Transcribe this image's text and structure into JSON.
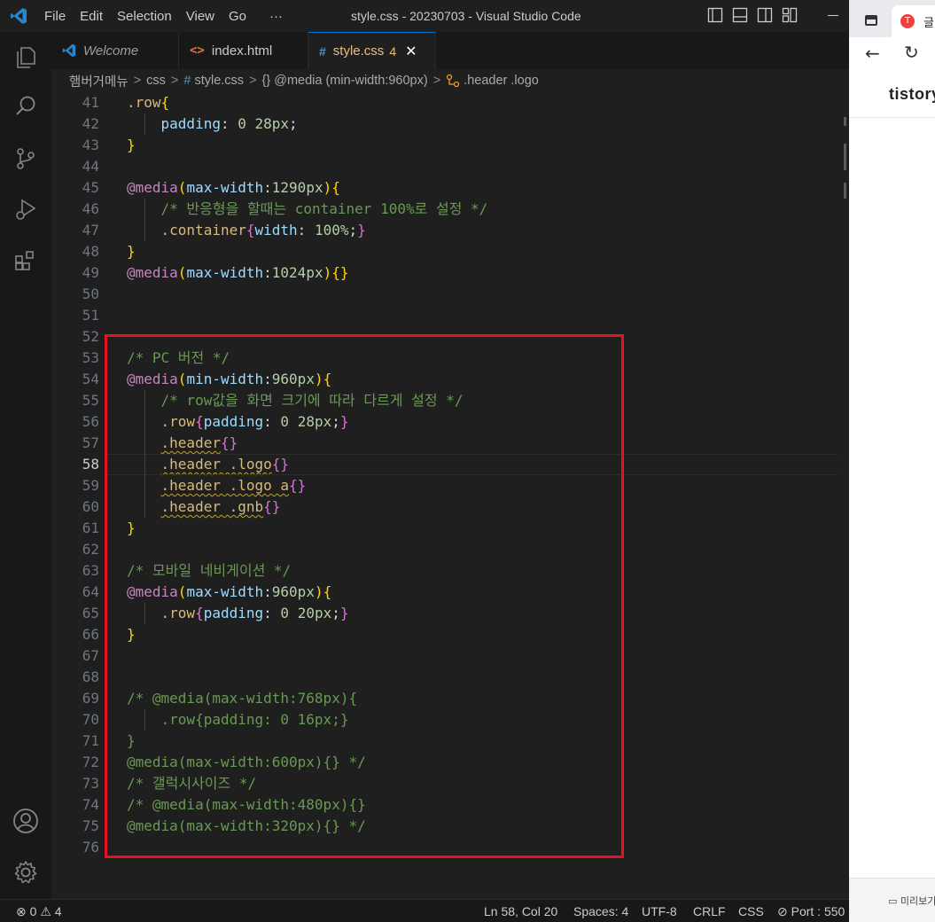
{
  "window": {
    "title": "style.css - 20230703 - Visual Studio Code",
    "menu": [
      "File",
      "Edit",
      "Selection",
      "View",
      "Go",
      "···"
    ]
  },
  "activity": {
    "items": [
      "explorer-icon",
      "search-icon",
      "source-control-icon",
      "run-debug-icon",
      "extensions-icon",
      "account-icon",
      "settings-gear-icon"
    ]
  },
  "tabs": [
    {
      "label": "Welcome",
      "icon": "vscode-icon"
    },
    {
      "label": "index.html",
      "icon": "html-icon"
    },
    {
      "label": "style.css",
      "icon": "css-icon",
      "badge": "4",
      "close": "✕",
      "active": true
    }
  ],
  "breadcrumb": {
    "folder": "햄버거메뉴",
    "subfolder": "css",
    "file_hash": "#",
    "file": "style.css",
    "media_icon": "{}",
    "media": "@media (min-width:960px)",
    "symbol": ".header .logo",
    "separator": ">"
  },
  "editor": {
    "current_line": 58,
    "colors": {
      "selector": "#d7ba7d",
      "property": "#9cdcfe",
      "number": "#b5cea8",
      "keyword": "#c586c0",
      "comment": "#6a9955",
      "bracket1": "#ffd700",
      "bracket2": "#da70d6",
      "bracket3": "#179fff"
    },
    "lines": [
      {
        "n": "41",
        "tokens": [
          [
            "sel",
            ".row"
          ],
          [
            "b1",
            "{"
          ]
        ]
      },
      {
        "n": "42",
        "tokens": [
          [
            "pl",
            "    "
          ],
          [
            "prop",
            "padding"
          ],
          [
            "pl",
            ": "
          ],
          [
            "num",
            "0"
          ],
          [
            "pl",
            " "
          ],
          [
            "num",
            "28px"
          ],
          [
            "pl",
            ";"
          ]
        ]
      },
      {
        "n": "43",
        "tokens": [
          [
            "b1",
            "}"
          ]
        ]
      },
      {
        "n": "44",
        "tokens": []
      },
      {
        "n": "45",
        "tokens": [
          [
            "kw",
            "@media"
          ],
          [
            "b1",
            "("
          ],
          [
            "prop",
            "max-width"
          ],
          [
            "pl",
            ":"
          ],
          [
            "num",
            "1290px"
          ],
          [
            "b1",
            ")"
          ],
          [
            "b1",
            "{"
          ]
        ]
      },
      {
        "n": "46",
        "tokens": [
          [
            "pl",
            "    "
          ],
          [
            "com",
            "/* 반응형을 할때는 container 100%로 설정 */"
          ]
        ]
      },
      {
        "n": "47",
        "tokens": [
          [
            "pl",
            "    "
          ],
          [
            "sel",
            ".container"
          ],
          [
            "b2",
            "{"
          ],
          [
            "prop",
            "width"
          ],
          [
            "pl",
            ": "
          ],
          [
            "num",
            "100%"
          ],
          [
            "pl",
            ";"
          ],
          [
            "b2",
            "}"
          ]
        ]
      },
      {
        "n": "48",
        "tokens": [
          [
            "b1",
            "}"
          ]
        ]
      },
      {
        "n": "49",
        "tokens": [
          [
            "kw",
            "@media"
          ],
          [
            "b1",
            "("
          ],
          [
            "prop",
            "max-width"
          ],
          [
            "pl",
            ":"
          ],
          [
            "num",
            "1024px"
          ],
          [
            "b1",
            ")"
          ],
          [
            "b1",
            "{}"
          ]
        ]
      },
      {
        "n": "50",
        "tokens": []
      },
      {
        "n": "51",
        "tokens": []
      },
      {
        "n": "52",
        "tokens": []
      },
      {
        "n": "53",
        "tokens": [
          [
            "com",
            "/* PC 버전 */"
          ]
        ]
      },
      {
        "n": "54",
        "tokens": [
          [
            "kw",
            "@media"
          ],
          [
            "b1",
            "("
          ],
          [
            "prop",
            "min-width"
          ],
          [
            "pl",
            ":"
          ],
          [
            "num",
            "960px"
          ],
          [
            "b1",
            ")"
          ],
          [
            "b1",
            "{"
          ]
        ]
      },
      {
        "n": "55",
        "tokens": [
          [
            "pl",
            "    "
          ],
          [
            "com",
            "/* row값을 화면 크기에 따라 다르게 설정 */"
          ]
        ]
      },
      {
        "n": "56",
        "tokens": [
          [
            "pl",
            "    "
          ],
          [
            "sel",
            ".row"
          ],
          [
            "b2",
            "{"
          ],
          [
            "prop",
            "padding"
          ],
          [
            "pl",
            ": "
          ],
          [
            "num",
            "0"
          ],
          [
            "pl",
            " "
          ],
          [
            "num",
            "28px"
          ],
          [
            "pl",
            ";"
          ],
          [
            "b2",
            "}"
          ]
        ]
      },
      {
        "n": "57",
        "tokens": [
          [
            "pl",
            "    "
          ],
          [
            "sel sq",
            ".header"
          ],
          [
            "b2",
            "{}"
          ]
        ]
      },
      {
        "n": "58",
        "tokens": [
          [
            "pl",
            "    "
          ],
          [
            "sel sq",
            ".header .logo"
          ],
          [
            "b2",
            "{}"
          ]
        ]
      },
      {
        "n": "59",
        "tokens": [
          [
            "pl",
            "    "
          ],
          [
            "sel sq",
            ".header .logo a"
          ],
          [
            "b2",
            "{}"
          ]
        ]
      },
      {
        "n": "60",
        "tokens": [
          [
            "pl",
            "    "
          ],
          [
            "sel sq",
            ".header .gnb"
          ],
          [
            "b2",
            "{}"
          ]
        ]
      },
      {
        "n": "61",
        "tokens": [
          [
            "b1",
            "}"
          ]
        ]
      },
      {
        "n": "62",
        "tokens": []
      },
      {
        "n": "63",
        "tokens": [
          [
            "com",
            "/* 모바일 네비게이션 */"
          ]
        ]
      },
      {
        "n": "64",
        "tokens": [
          [
            "kw",
            "@media"
          ],
          [
            "b1",
            "("
          ],
          [
            "prop",
            "max-width"
          ],
          [
            "pl",
            ":"
          ],
          [
            "num",
            "960px"
          ],
          [
            "b1",
            ")"
          ],
          [
            "b1",
            "{"
          ]
        ]
      },
      {
        "n": "65",
        "tokens": [
          [
            "pl",
            "    "
          ],
          [
            "sel",
            ".row"
          ],
          [
            "b2",
            "{"
          ],
          [
            "prop",
            "padding"
          ],
          [
            "pl",
            ": "
          ],
          [
            "num",
            "0"
          ],
          [
            "pl",
            " "
          ],
          [
            "num",
            "20px"
          ],
          [
            "pl",
            ";"
          ],
          [
            "b2",
            "}"
          ]
        ]
      },
      {
        "n": "66",
        "tokens": [
          [
            "b1",
            "}"
          ]
        ]
      },
      {
        "n": "67",
        "tokens": []
      },
      {
        "n": "68",
        "tokens": []
      },
      {
        "n": "69",
        "tokens": [
          [
            "com",
            "/* @media(max-width:768px){"
          ]
        ]
      },
      {
        "n": "70",
        "tokens": [
          [
            "com",
            "    .row{padding: 0 16px;}"
          ]
        ]
      },
      {
        "n": "71",
        "tokens": [
          [
            "com",
            "}"
          ]
        ]
      },
      {
        "n": "72",
        "tokens": [
          [
            "com",
            "@media(max-width:600px){} */"
          ]
        ]
      },
      {
        "n": "73",
        "tokens": [
          [
            "com",
            "/* 갤럭시사이즈 */"
          ]
        ]
      },
      {
        "n": "74",
        "tokens": [
          [
            "com",
            "/* @media(max-width:480px){}"
          ]
        ]
      },
      {
        "n": "75",
        "tokens": [
          [
            "com",
            "@media(max-width:320px){} */"
          ]
        ]
      },
      {
        "n": "76",
        "tokens": []
      }
    ]
  },
  "status": {
    "errors": "0",
    "warnings": "4",
    "position": "Ln 58, Col 20",
    "spaces": "Spaces: 4",
    "encoding": "UTF-8",
    "eol": "CRLF",
    "language": "CSS",
    "port": "Port : 550"
  },
  "browser": {
    "tab_title": "글",
    "favicon_letter": "T",
    "brand": "tistory",
    "preview_label": "미리보기"
  }
}
